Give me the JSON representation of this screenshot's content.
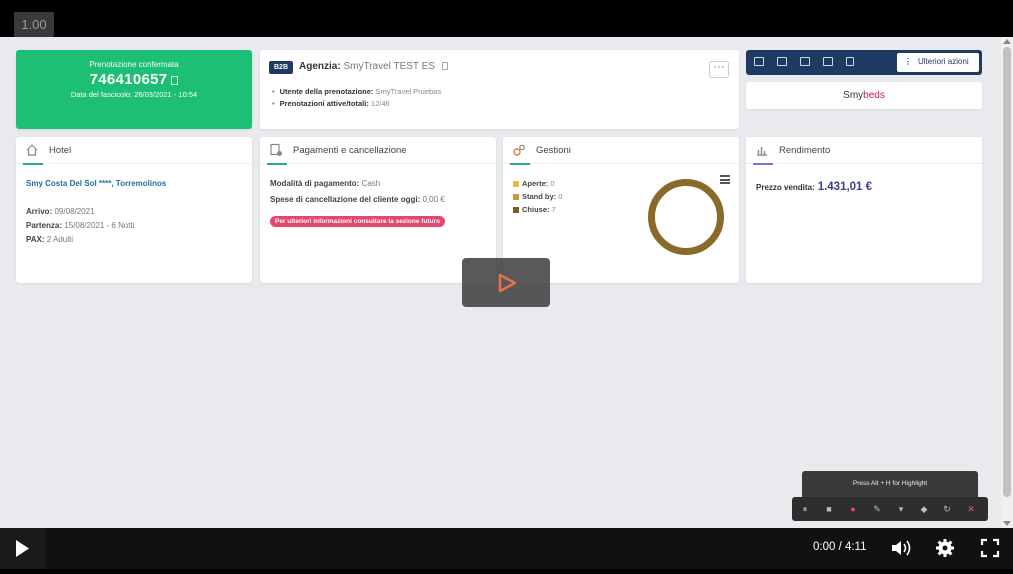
{
  "player": {
    "speed": "1.00",
    "time": "0:00 / 4:11"
  },
  "booking": {
    "status_label": "Prenotazione confermata",
    "number": "746410657",
    "date_line": "Data del fascicolo: 26/03/2021 - 10:54",
    "color": "#1cbf73"
  },
  "agency": {
    "badge": "B2B",
    "label": "Agenzia:",
    "name": "SmyTravel TEST ES",
    "menu": "···",
    "user_label": "Utente della prenotazione:",
    "user_value": "SmyTravel Pruebas",
    "active_label": "Prenotazioni attive/totali:",
    "active_value": "12/46"
  },
  "toolbar": {
    "more_label": "Ulteriori azioni",
    "logo_smy": "Smy",
    "logo_beds": "beds",
    "color": "#1e3a62"
  },
  "hotel": {
    "title": "Hotel",
    "name": "Smy Costa Del Sol ****, Torremolinos",
    "arrival_label": "Arrivo:",
    "arrival_value": "09/08/2021",
    "departure_label": "Partenza:",
    "departure_value": "15/08/2021 - 6 Notti",
    "pax_label": "PAX:",
    "pax_value": "2 Adulti"
  },
  "payments": {
    "title": "Pagamenti e cancellazione",
    "method_label": "Modalità di pagamento:",
    "method_value": "Cash",
    "cancel_label": "Spese di cancellazione del cliente oggi:",
    "cancel_value": "0,00 €",
    "notice": "Per ulteriori informazioni consultare la sezione futuro"
  },
  "gestioni": {
    "title": "Gestioni",
    "items": [
      {
        "label": "Aperte:",
        "value": "0",
        "color": "#e8b84a"
      },
      {
        "label": "Stand by:",
        "value": "0",
        "color": "#c49a3a"
      },
      {
        "label": "Chiuse:",
        "value": "7",
        "color": "#7a5a20"
      }
    ]
  },
  "rendimento": {
    "title": "Rendimento",
    "price_label": "Prezzo vendita:",
    "price_value": "1.431,01 €"
  },
  "recorder": {
    "hint": "Press Alt + H for Highlight"
  }
}
